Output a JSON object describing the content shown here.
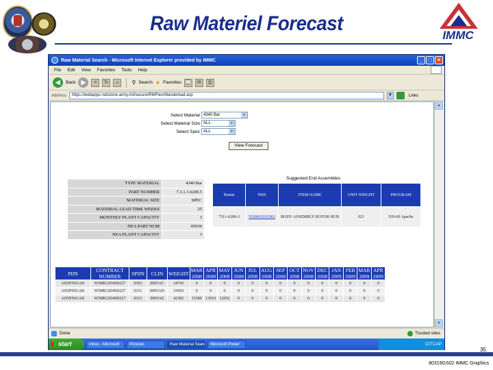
{
  "slide": {
    "title": "Raw Materiel Forecast",
    "logo_text": "IMMC",
    "slide_number": "35",
    "footer": "80319GS02 IMMC Graphics"
  },
  "browser": {
    "window_title": "Raw Material Search - Microsoft Internet Explorer provided by IMMC",
    "menu": [
      "File",
      "Edit",
      "View",
      "Favorites",
      "Tools",
      "Help"
    ],
    "toolbar": {
      "back_label": "Back",
      "search_label": "Search",
      "favorites_label": "Favorites"
    },
    "address_label": "Address",
    "address_value": "https://webapps.redstone.army.mil/secure/RMFlex/Wanderbad.asp",
    "links_label": "Links",
    "status_text": "Done",
    "zone_text": "Trusted sites"
  },
  "form": {
    "fields": [
      {
        "label": "Select Material",
        "value": "4340 Bar"
      },
      {
        "label": "Select Material Size",
        "value": "ALL"
      },
      {
        "label": "Select Spec",
        "value": "ALL"
      }
    ],
    "submit_label": "View Forecast"
  },
  "material_info": [
    {
      "label": "TYPE MATERIAL",
      "value": "4340 Bar"
    },
    {
      "label": "PART NUMBER",
      "value": "7.3.1.1.6200.5"
    },
    {
      "label": "MATERIAL SIZE",
      "value": "SPEC"
    },
    {
      "label": "MATERIAL LEAD TIME WEEKS",
      "value": "25"
    },
    {
      "label": "MONTHLY PLANT CAPACITY",
      "value": "3"
    },
    {
      "label": "NEA PART NUM",
      "value": "05930"
    },
    {
      "label": "NEA PLANT CAPACITY",
      "value": "3"
    }
  ],
  "item_table": {
    "caption": "Suggested End Assemblies",
    "headers": [
      "Parent",
      "NSN",
      "ITEM NAME",
      "UNIT WEIGHT",
      "PROGRAM"
    ],
    "row": [
      "7311-6200-3",
      "5930010161963",
      "BODY ASSEMBLY ROTOR HUB",
      "021",
      "UH-60 Apache"
    ]
  },
  "forecast_table": {
    "headers": [
      "PIIN",
      "CONTRACT NUMBER",
      "SPIIN",
      "CLIN",
      "WEIGHT",
      "MAR 2008",
      "APR 2008",
      "MAY 2008",
      "JUN 2008",
      "JUL 2008",
      "AUG 2008",
      "SEP 2008",
      "OCT 2008",
      "NOV 2008",
      "DEC 2008",
      "JAN 2009",
      "FEB 2009",
      "MAR 2009",
      "APR 2009"
    ],
    "rows": [
      [
        "AH3P56GAK",
        "W58RGZ04D0227",
        "0303",
        "0005AC",
        "24743",
        "0",
        "0",
        "0",
        "0",
        "0",
        "0",
        "0",
        "0",
        "0",
        "0",
        "0",
        "0",
        "0",
        "0"
      ],
      [
        "AH3P56GAK",
        "W58RGZ04D0227",
        "0311",
        "0005AD",
        "33693",
        "0",
        "0",
        "0",
        "0",
        "0",
        "0",
        "0",
        "0",
        "0",
        "0",
        "0",
        "0",
        "0",
        "0"
      ],
      [
        "AH3P56GAK",
        "W58RGZ04D0227",
        "0313",
        "0005AE",
        "42382",
        "15380",
        "13910",
        "12052",
        "0",
        "0",
        "0",
        "0",
        "0",
        "0",
        "0",
        "0",
        "0",
        "0",
        "0"
      ]
    ]
  },
  "taskbar": {
    "start_label": "start",
    "tasks": [
      "Inbox - Microsoft",
      "Pictures",
      "Raw Material Search",
      "Microsoft Power"
    ],
    "tray": "CITCAP"
  }
}
